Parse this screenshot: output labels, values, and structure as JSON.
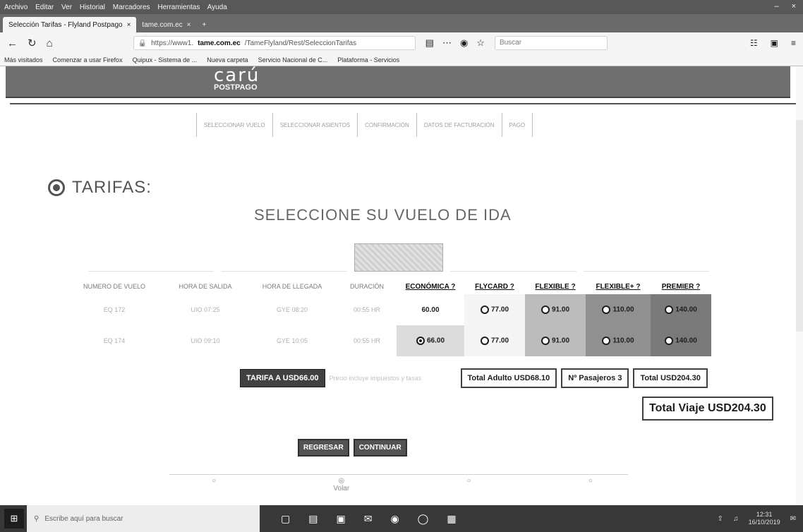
{
  "browser": {
    "menu": [
      "Archivo",
      "Editar",
      "Ver",
      "Historial",
      "Marcadores",
      "Herramientas",
      "Ayuda"
    ],
    "tabs": [
      {
        "label": "Selección Tarifas - Flyland Postpago"
      },
      {
        "label": "tame.com.ec"
      }
    ],
    "url_prefix": "https://www1.",
    "url_domain": "tame.com.ec",
    "url_path": "/TameFlyland/Rest/SeleccionTarifas",
    "search_placeholder": "Buscar",
    "bookmarks": [
      "Más visitados",
      "Comenzar a usar Firefox",
      "Quipux - Sistema de ...",
      "Nueva carpeta",
      "Servicio Nacional de C...",
      "Plataforma - Servicios"
    ]
  },
  "header": {
    "logo_text": "carú",
    "logo_sub": "POSTPAGO"
  },
  "steps": [
    "SELECCIONAR VUELO",
    "SELECCIONAR ASIENTOS",
    "CONFIRMACIÓN",
    "DATOS DE FACTURACIÓN",
    "PAGO"
  ],
  "section": {
    "title": "TARIFAS:",
    "subtitle": "SELECCIONE SU VUELO DE IDA"
  },
  "table": {
    "columns": [
      "NUMERO DE VUELO",
      "HORA DE SALIDA",
      "HORA DE LLEGADA",
      "DURACIÓN"
    ],
    "fare_columns": [
      "ECONÓMICA ?",
      "FLYCARD ?",
      "FLEXIBLE ?",
      "FLEXIBLE+ ?",
      "PREMIER ?"
    ],
    "rows": [
      {
        "flight": "EQ 172",
        "dep": "UIO 07:25",
        "arr": "GYE 08:20",
        "dur": "00:55 HR",
        "fares": [
          "60.00",
          "77.00",
          "91.00",
          "110.00",
          "140.00"
        ]
      },
      {
        "flight": "EQ 174",
        "dep": "UIO 09:10",
        "arr": "GYE 10:05",
        "dur": "00:55 HR",
        "fares": [
          "66.00",
          "77.00",
          "91.00",
          "110.00",
          "140.00"
        ]
      }
    ]
  },
  "summary": {
    "tarifa_label": "TARIFA A",
    "tarifa_value": "USD66.00",
    "note": "Precio incluye impuestos y tasas",
    "total_adulto": "Total Adulto USD68.10",
    "pasajeros": "Nº Pasajeros 3",
    "total": "Total USD204.30",
    "total_viaje": "Total Viaje USD204.30"
  },
  "buttons": {
    "back": "REGRESAR",
    "continue": "CONTINUAR"
  },
  "footer": {
    "icons": [
      "",
      "Volar",
      "",
      ""
    ]
  },
  "taskbar": {
    "search_text": "Escribe aquí para buscar",
    "time": "12:31",
    "date": "16/10/2019"
  }
}
